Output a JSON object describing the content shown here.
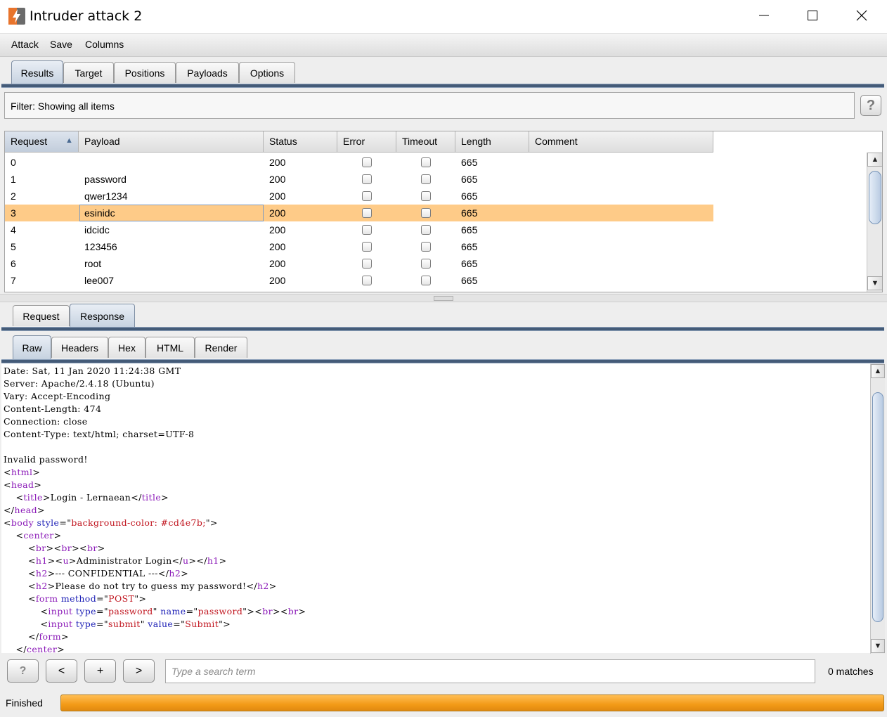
{
  "window": {
    "title": "Intruder attack 2",
    "controls": {
      "minimize": "minimize-icon",
      "maximize": "maximize-icon",
      "close": "close-icon"
    }
  },
  "menu": [
    "Attack",
    "Save",
    "Columns"
  ],
  "main_tabs": [
    "Results",
    "Target",
    "Positions",
    "Payloads",
    "Options"
  ],
  "main_tabs_active": "Results",
  "filter": {
    "text": "Filter:  Showing all items",
    "help": "?"
  },
  "table": {
    "columns": [
      "Request",
      "Payload",
      "Status",
      "Error",
      "Timeout",
      "Length",
      "Comment"
    ],
    "sort_indicator": "▲",
    "rows": [
      {
        "request": "0",
        "payload": "",
        "status": "200",
        "error": false,
        "timeout": false,
        "length": "665",
        "comment": ""
      },
      {
        "request": "1",
        "payload": "password",
        "status": "200",
        "error": false,
        "timeout": false,
        "length": "665",
        "comment": ""
      },
      {
        "request": "2",
        "payload": "qwer1234",
        "status": "200",
        "error": false,
        "timeout": false,
        "length": "665",
        "comment": ""
      },
      {
        "request": "3",
        "payload": "esinidc",
        "status": "200",
        "error": false,
        "timeout": false,
        "length": "665",
        "comment": ""
      },
      {
        "request": "4",
        "payload": "idcidc",
        "status": "200",
        "error": false,
        "timeout": false,
        "length": "665",
        "comment": ""
      },
      {
        "request": "5",
        "payload": "123456",
        "status": "200",
        "error": false,
        "timeout": false,
        "length": "665",
        "comment": ""
      },
      {
        "request": "6",
        "payload": "root",
        "status": "200",
        "error": false,
        "timeout": false,
        "length": "665",
        "comment": ""
      },
      {
        "request": "7",
        "payload": "lee007",
        "status": "200",
        "error": false,
        "timeout": false,
        "length": "665",
        "comment": ""
      }
    ],
    "selected_row": "3",
    "highlight_color": "#fecb88"
  },
  "message_tabs": [
    "Request",
    "Response"
  ],
  "message_tabs_active": "Response",
  "view_tabs": [
    "Raw",
    "Headers",
    "Hex",
    "HTML",
    "Render"
  ],
  "view_tabs_active": "Raw",
  "response_lines": [
    "Date: Sat, 11 Jan 2020 11:24:38 GMT",
    "Server: Apache/2.4.18 (Ubuntu)",
    "Vary: Accept-Encoding",
    "Content-Length: 474",
    "Connection: close",
    "Content-Type: text/html; charset=UTF-8",
    "",
    "Invalid password!",
    "<html>",
    "<head>",
    "    <title>Login - Lernaean</title>",
    "</head>",
    "<body style=\"background-color: #cd4e7b;\">",
    "    <center>",
    "        <br><br><br>",
    "        <h1><u>Administrator Login</u></h1>",
    "        <h2>--- CONFIDENTIAL ---</h2>",
    "        <h2>Please do not try to guess my password!</h2>",
    "        <form method=\"POST\">",
    "            <input type=\"password\" name=\"password\"><br><br>",
    "            <input type=\"submit\" value=\"Submit\">",
    "        </form>",
    "    </center>"
  ],
  "search": {
    "help": "?",
    "prev": "<",
    "add": "+",
    "next": ">",
    "placeholder": "Type a search term",
    "matches": "0 matches"
  },
  "status": {
    "text": "Finished",
    "progress": 1.0,
    "progress_color": "#f39a17"
  }
}
